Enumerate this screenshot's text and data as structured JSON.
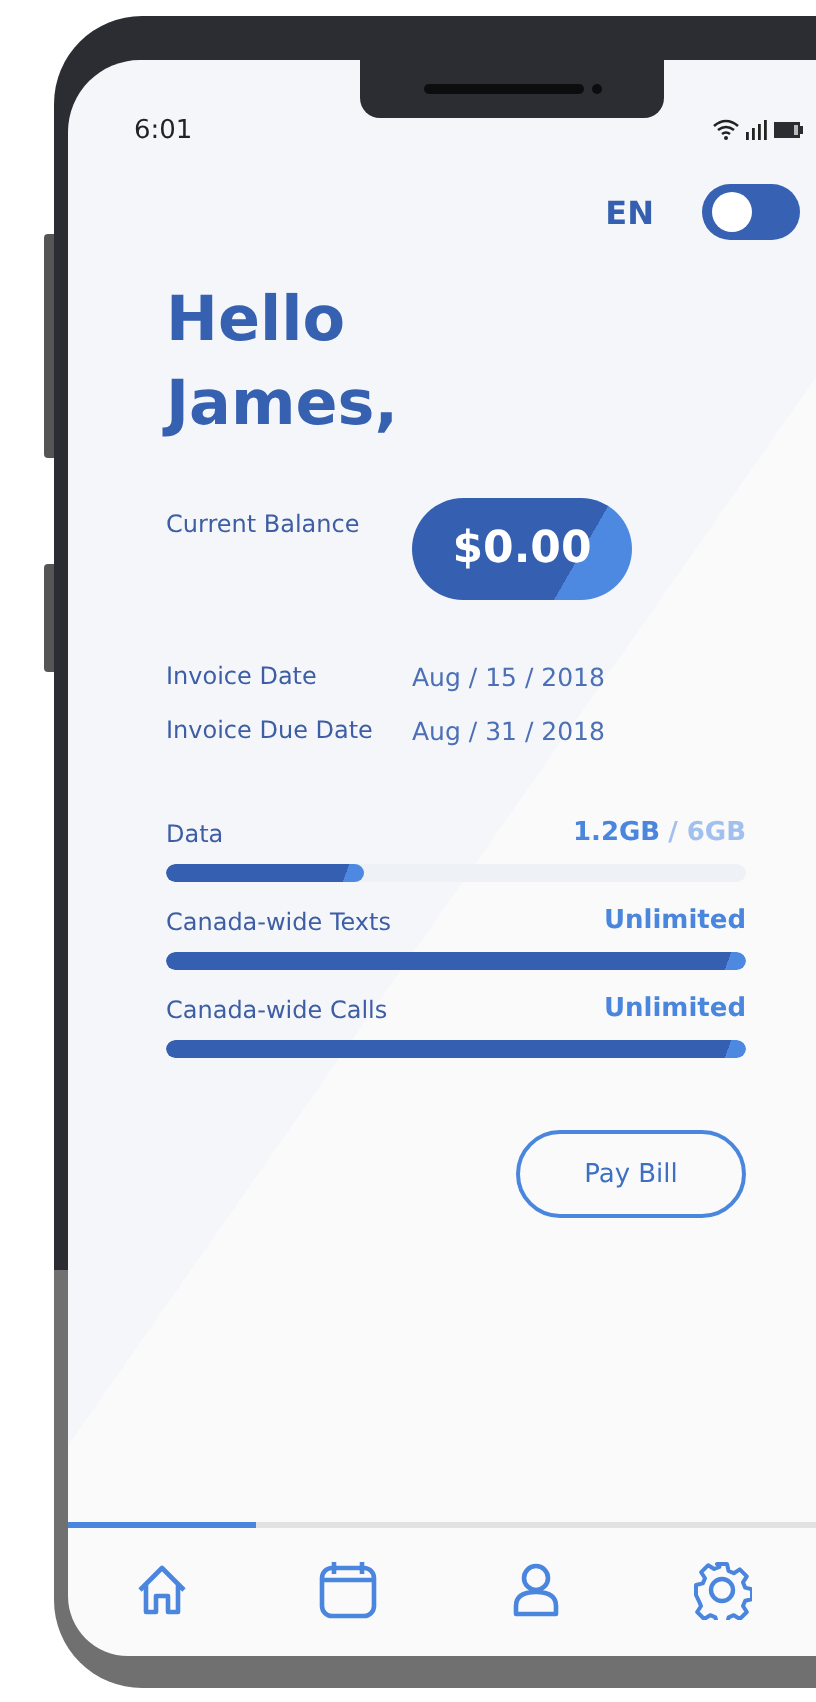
{
  "status_bar": {
    "time": "6:01"
  },
  "language": {
    "label": "EN",
    "toggle_on": false
  },
  "greeting": [
    "Hello",
    "James,"
  ],
  "balance": {
    "label": "Current Balance",
    "amount": "$0.00"
  },
  "invoice": [
    {
      "label": "Invoice Date",
      "value": "Aug / 15 / 2018"
    },
    {
      "label": "Invoice Due Date",
      "value": "Aug / 31 / 2018"
    }
  ],
  "usage": [
    {
      "name": "Data",
      "used": "1.2GB",
      "total": "/ 6GB",
      "level": 0.34
    },
    {
      "name": "Canada-wide Texts",
      "used": "Unlimited",
      "level": 1
    },
    {
      "name": "Canada-wide Calls",
      "used": "Unlimited",
      "level": 1
    }
  ],
  "pay_button": "Pay Bill",
  "nav": [
    {
      "kind": "home",
      "selected": true
    },
    {
      "kind": "calendar",
      "selected": false
    },
    {
      "kind": "profile",
      "selected": false
    },
    {
      "kind": "settings",
      "selected": false
    }
  ]
}
